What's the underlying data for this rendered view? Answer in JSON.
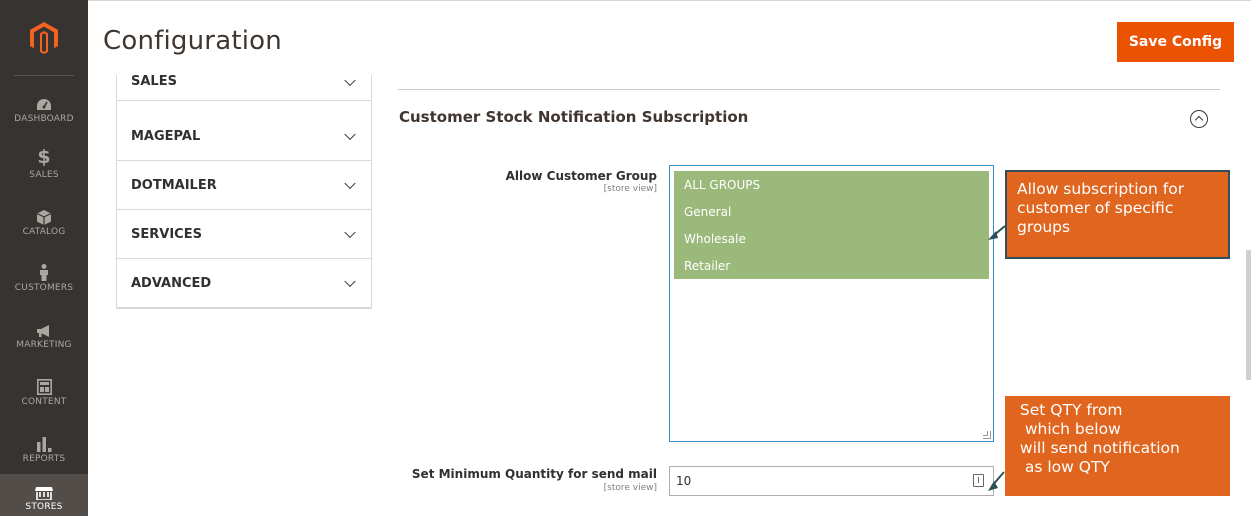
{
  "header": {
    "title": "Configuration",
    "save_label": "Save Config"
  },
  "nav": {
    "items": [
      {
        "label": "DASHBOARD",
        "icon": "gauge-icon"
      },
      {
        "label": "SALES",
        "icon": "dollar-icon"
      },
      {
        "label": "CATALOG",
        "icon": "box-icon"
      },
      {
        "label": "CUSTOMERS",
        "icon": "person-icon"
      },
      {
        "label": "MARKETING",
        "icon": "megaphone-icon"
      },
      {
        "label": "CONTENT",
        "icon": "layout-icon"
      },
      {
        "label": "REPORTS",
        "icon": "bar-chart-icon"
      },
      {
        "label": "STORES",
        "icon": "store-icon"
      }
    ]
  },
  "tabs": [
    {
      "label": "SALES"
    },
    {
      "label": "MAGEPAL"
    },
    {
      "label": "DOTMAILER"
    },
    {
      "label": "SERVICES"
    },
    {
      "label": "ADVANCED"
    }
  ],
  "section": {
    "title": "Customer Stock Notification Subscription",
    "fields": {
      "group": {
        "label": "Allow Customer Group",
        "scope": "[store view]",
        "options": [
          "ALL GROUPS",
          "General",
          "Wholesale",
          "Retailer"
        ]
      },
      "qty": {
        "label": "Set Minimum Quantity for send mail",
        "scope": "[store view]",
        "value": "10"
      }
    }
  },
  "annotations": {
    "subscription": "Allow subscription for customer of specific groups",
    "qty_lines": [
      " Set QTY from",
      "  which below",
      " will send notification",
      "  as low QTY"
    ]
  },
  "colors": {
    "accent": "#eb5202",
    "nav_bg": "#373330",
    "selected_option": "#9bb97b",
    "callout": "#e0651f"
  }
}
